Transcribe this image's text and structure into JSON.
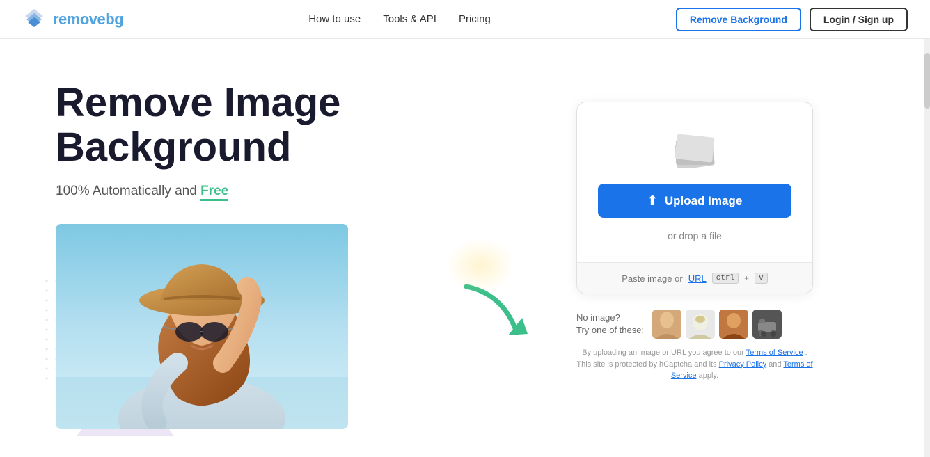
{
  "header": {
    "logo_text_main": "remove",
    "logo_text_accent": "bg",
    "nav": [
      {
        "label": "How to use",
        "id": "how-to-use"
      },
      {
        "label": "Tools & API",
        "id": "tools-api"
      },
      {
        "label": "Pricing",
        "id": "pricing"
      }
    ],
    "btn_remove_bg": "Remove Background",
    "btn_login": "Login / Sign up"
  },
  "hero": {
    "title_line1": "Remove Image",
    "title_line2": "Background",
    "subtitle_plain": "100% Automatically and ",
    "subtitle_free": "Free"
  },
  "upload_card": {
    "upload_btn_label": "Upload Image",
    "drop_label": "or drop a file",
    "paste_label": "Paste image or",
    "url_label": "URL",
    "kbd1": "ctrl",
    "plus": "+",
    "kbd2": "v",
    "no_image_label": "No image?",
    "try_one_label": "Try one of these:"
  },
  "terms": {
    "text1": "By uploading an image or URL you agree to our",
    "tos_link": "Terms of Service",
    "text2": ". This site is protected by hCaptcha and its",
    "privacy_link": "Privacy Policy",
    "text3": "and",
    "tos_link2": "Terms of Service",
    "text4": "apply."
  }
}
